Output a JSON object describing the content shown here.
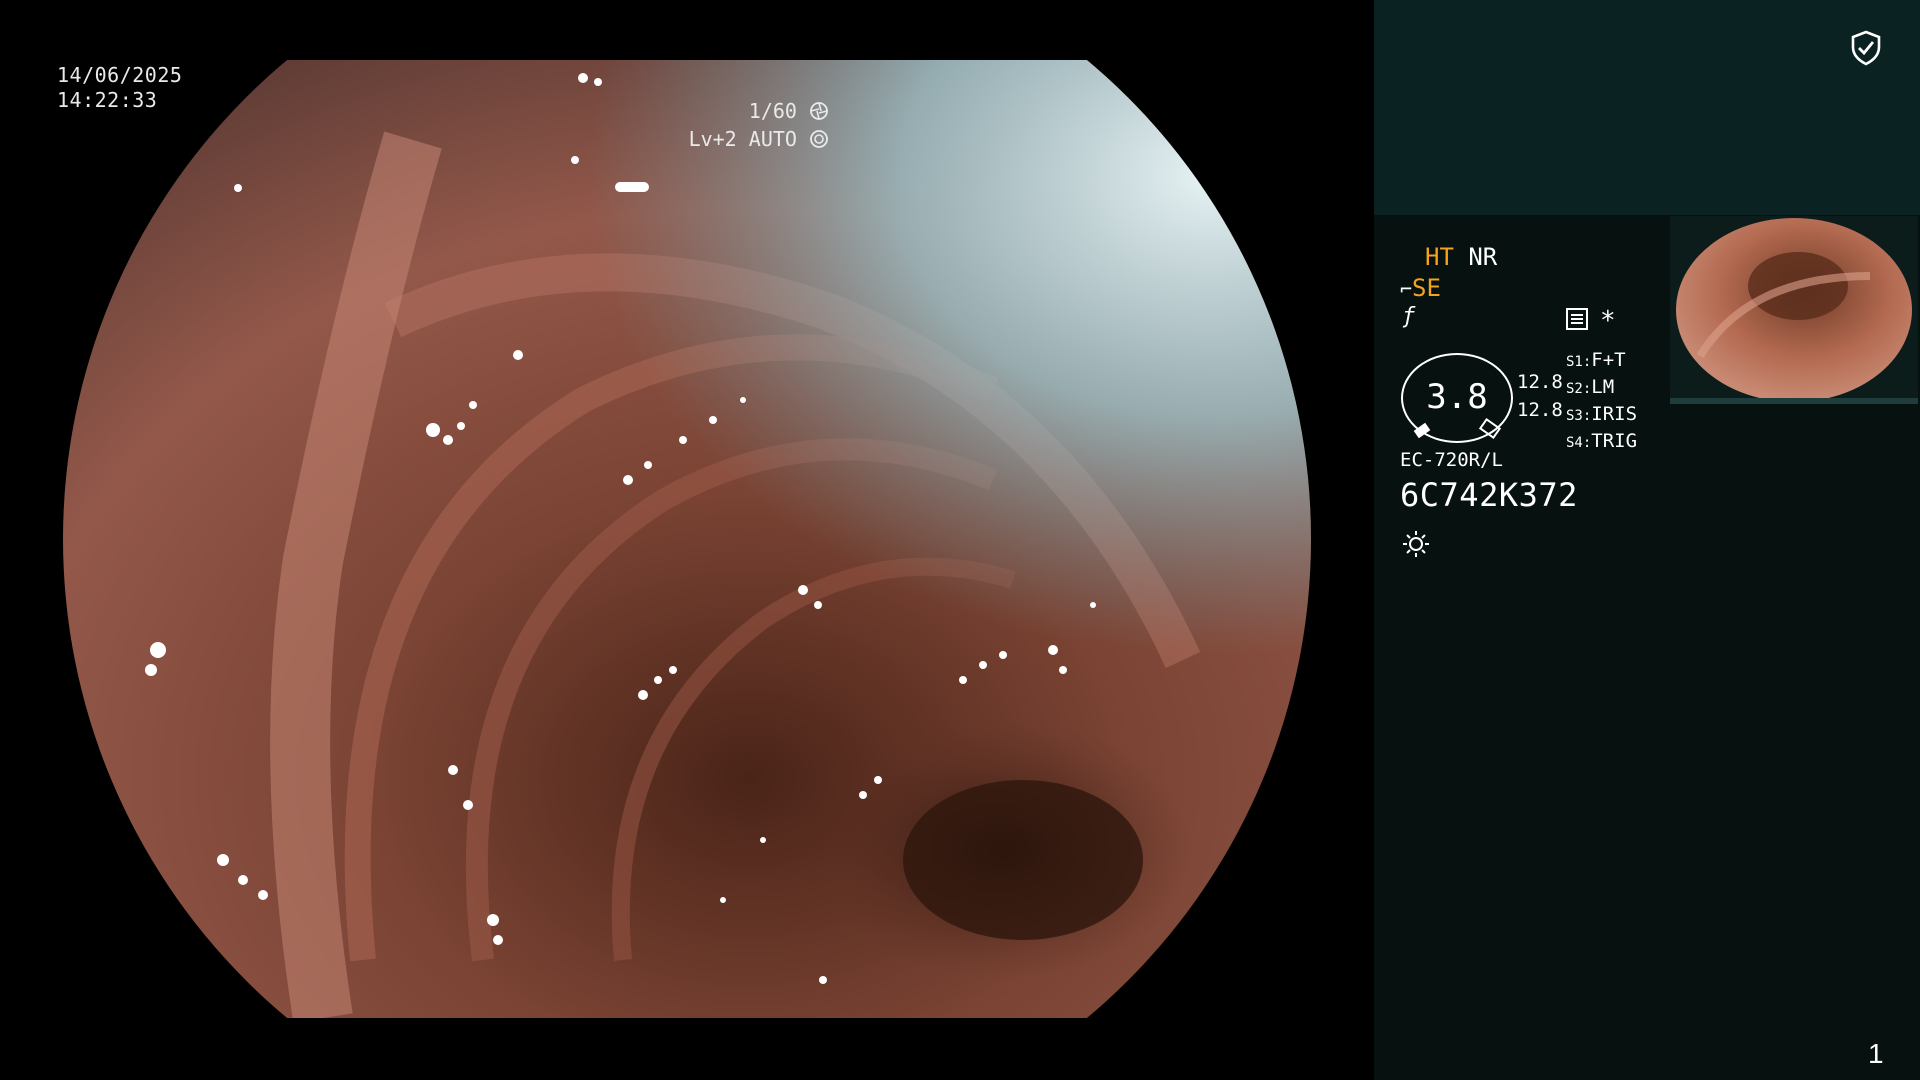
{
  "scope": {
    "date": "14/06/2025",
    "time": "14:22:33",
    "shutter": "1/60",
    "level": "Lv+2",
    "mode": "AUTO"
  },
  "panel": {
    "ht_label": "HT",
    "nr_label": "NR",
    "se_label": "SE",
    "asterisk": "*",
    "zoom_value": "3.8",
    "readout_1": "12.8",
    "readout_2": "12.8",
    "switches": [
      {
        "key": "S1:",
        "value": "F+T"
      },
      {
        "key": "S2:",
        "value": "LM"
      },
      {
        "key": "S3:",
        "value": "IRIS"
      },
      {
        "key": "S4:",
        "value": "TRIG"
      }
    ],
    "scope_model": "EC-720R/L",
    "serial": "6C742K372",
    "page_number": "1",
    "colors": {
      "accent": "#f2a41c",
      "panel_bg": "#061110",
      "panel_top": "#0a2222"
    }
  },
  "icons": {
    "security": "shield-check-icon",
    "shutter": "aperture-icon",
    "auto": "iris-icon",
    "light": "sun-icon",
    "settings": "settings-list-icon"
  }
}
